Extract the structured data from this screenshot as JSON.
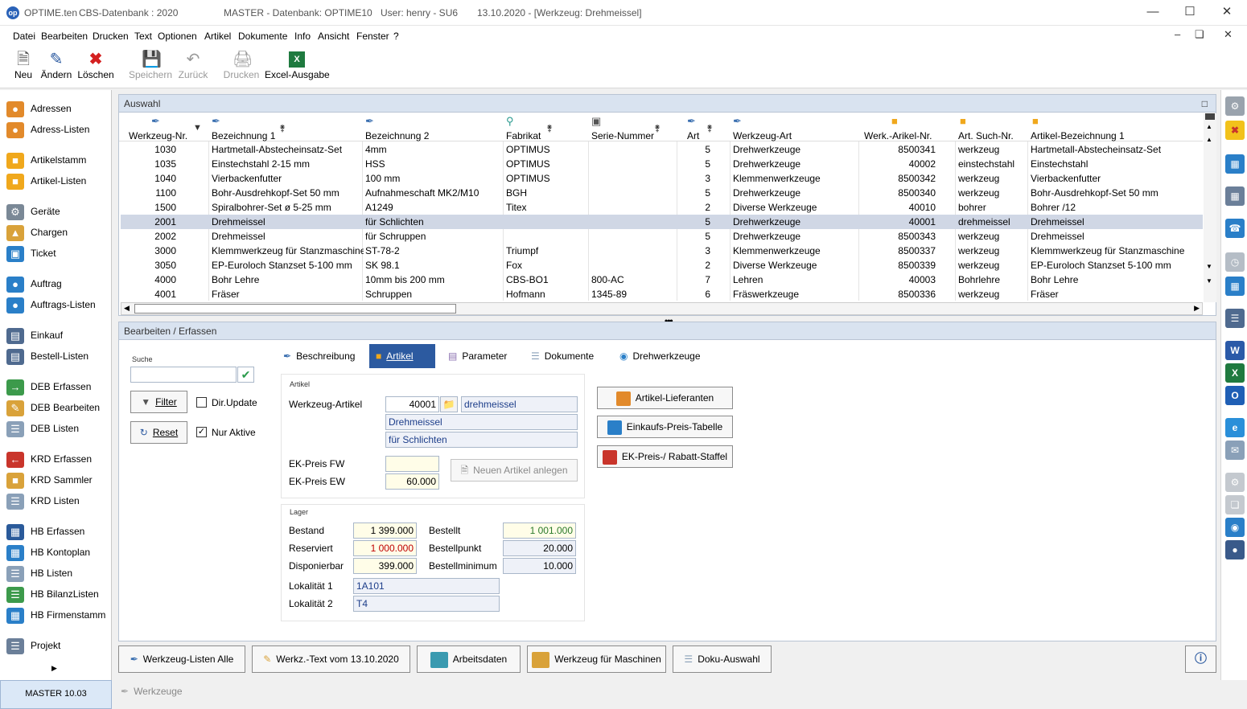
{
  "titlebar": {
    "app": "OPTIME.ten",
    "db": "CBS-Datenbank : 2020",
    "master": "MASTER - Datenbank:  OPTIME10",
    "user": "User:  henry  -  SU6",
    "date_tool": "13.10.2020 - [Werkzeug: Drehmeissel]"
  },
  "menu": [
    "Datei",
    "Bearbeiten",
    "Drucken",
    "Text",
    "Optionen",
    "Artikel",
    "Dokumente",
    "Info",
    "Ansicht",
    "Fenster",
    "?"
  ],
  "toolbar": {
    "neu": "Neu",
    "aendern": "Ändern",
    "loeschen": "Löschen",
    "speichern": "Speichern",
    "zurueck": "Zurück",
    "drucken": "Drucken",
    "excel": "Excel-Ausgabe"
  },
  "nav": [
    "Adressen",
    "Adress-Listen",
    "Artikelstamm",
    "Artikel-Listen",
    "Geräte",
    "Chargen",
    "Ticket",
    "Auftrag",
    "Auftrags-Listen",
    "Einkauf",
    "Bestell-Listen",
    "DEB Erfassen",
    "DEB Bearbeiten",
    "DEB Listen",
    "KRD Erfassen",
    "KRD Sammler",
    "KRD Listen",
    "HB Erfassen",
    "HB Kontoplan",
    "HB Listen",
    "HB BilanzListen",
    "HB Firmenstamm",
    "Projekt"
  ],
  "status": {
    "left": "MASTER   10.03",
    "right": "Werkzeuge"
  },
  "grid": {
    "title": "Auswahl",
    "columns": [
      "Werkzeug-Nr.",
      "Bezeichnung 1",
      "Bezeichnung 2",
      "Fabrikat",
      "Serie-Nummer",
      "Art",
      "Werkzeug-Art",
      "Werk.-Arikel-Nr.",
      "Art. Such-Nr.",
      "Artikel-Bezeichnung 1"
    ],
    "rows": [
      [
        "1030",
        "Hartmetall-Abstecheinsatz-Set",
        "4mm",
        "OPTIMUS",
        "",
        "5",
        "Drehwerkzeuge",
        "8500341",
        "werkzeug",
        "Hartmetall-Abstecheinsatz-Set"
      ],
      [
        "1035",
        "Einstechstahl 2-15 mm",
        "HSS",
        "OPTIMUS",
        "",
        "5",
        "Drehwerkzeuge",
        "40002",
        "einstechstahl",
        "Einstechstahl"
      ],
      [
        "1040",
        "Vierbackenfutter",
        "100 mm",
        "OPTIMUS",
        "",
        "3",
        "Klemmenwerkzeuge",
        "8500342",
        "werkzeug",
        "Vierbackenfutter"
      ],
      [
        "1100",
        "Bohr-Ausdrehkopf-Set 50 mm",
        "Aufnahmeschaft MK2/M10",
        "BGH",
        "",
        "5",
        "Drehwerkzeuge",
        "8500340",
        "werkzeug",
        "Bohr-Ausdrehkopf-Set 50 mm"
      ],
      [
        "1500",
        "Spiralbohrer-Set ø 5-25 mm",
        "A1249",
        "Titex",
        "",
        "2",
        "Diverse Werkzeuge",
        "40010",
        "bohrer",
        "Bohrer /12"
      ],
      [
        "2001",
        "Drehmeissel",
        "für Schlichten",
        "",
        "",
        "5",
        "Drehwerkzeuge",
        "40001",
        "drehmeissel",
        "Drehmeissel"
      ],
      [
        "2002",
        "Drehmeissel",
        "für Schruppen",
        "",
        "",
        "5",
        "Drehwerkzeuge",
        "8500343",
        "werkzeug",
        "Drehmeissel"
      ],
      [
        "3000",
        "Klemmwerkzeug für Stanzmaschine",
        "ST-78-2",
        "Triumpf",
        "",
        "3",
        "Klemmenwerkzeuge",
        "8500337",
        "werkzeug",
        "Klemmwerkzeug für Stanzmaschine"
      ],
      [
        "3050",
        "EP-Euroloch Stanzset 5-100 mm",
        "SK 98.1",
        "Fox",
        "",
        "2",
        "Diverse Werkzeuge",
        "8500339",
        "werkzeug",
        "EP-Euroloch Stanzset 5-100 mm"
      ],
      [
        "4000",
        "Bohr Lehre",
        "10mm bis 200 mm",
        "CBS-BO1",
        "800-AC",
        "7",
        "Lehren",
        "40003",
        "Bohrlehre",
        "Bohr Lehre"
      ],
      [
        "4001",
        "Fräser",
        "Schruppen",
        "Hofmann",
        "1345-89",
        "6",
        "Fräswerkzeuge",
        "8500336",
        "werkzeug",
        "Fräser"
      ]
    ],
    "selected_row": 5
  },
  "edit": {
    "title": "Bearbeiten / Erfassen",
    "suche_label": "Suche",
    "suche_value": "",
    "filter": "Filter",
    "reset": "Reset",
    "dirupdate": "Dir.Update",
    "nuraktive": "Nur Aktive",
    "tabs": [
      "Beschreibung",
      "Artikel",
      "Parameter",
      "Dokumente",
      "Drehwerkzeuge"
    ],
    "active_tab": 1,
    "artikel_group": "Artikel",
    "werkzeug_artikel_label": "Werkzeug-Artikel",
    "werkzeug_artikel_nr": "40001",
    "werkzeug_artikel_such": "drehmeissel",
    "bez1": "Drehmeissel",
    "bez2": "für Schlichten",
    "ekfw_label": "EK-Preis FW",
    "ekfw_value": "",
    "ekew_label": "EK-Preis EW",
    "ekew_value": "60.000",
    "neuer_artikel": "Neuen Artikel anlegen",
    "lager_group": "Lager",
    "bestand_label": "Bestand",
    "bestand": "1 399.000",
    "reserviert_label": "Reserviert",
    "reserviert": "1 000.000",
    "disponierbar_label": "Disponierbar",
    "disponierbar": "399.000",
    "bestellt_label": "Bestellt",
    "bestellt": "1 001.000",
    "bestellpunkt_label": "Bestellpunkt",
    "bestellpunkt": "20.000",
    "bestellmin_label": "Bestellminimum",
    "bestellmin": "10.000",
    "lok1_label": "Lokalität 1",
    "lok1": "1A101",
    "lok2_label": "Lokalität 2",
    "lok2": "T4",
    "side_buttons": [
      "Artikel-Lieferanten",
      "Einkaufs-Preis-Tabelle",
      "EK-Preis-/ Rabatt-Staffel"
    ]
  },
  "bottom": [
    "Werkzeug-Listen Alle",
    "Werkz.-Text vom 13.10.2020",
    "Arbeitsdaten",
    "Werkzeug für Maschinen",
    "Doku-Auswahl"
  ],
  "colors": {
    "accent": "#2c5aa0",
    "selected_row": "#d0d7e5",
    "panel_header": "#d9e3f0"
  }
}
